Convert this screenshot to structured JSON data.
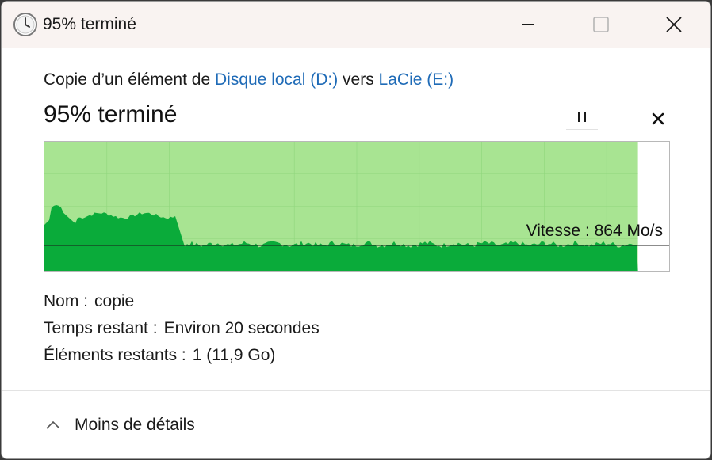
{
  "window": {
    "title": "95% terminé",
    "icon": "clock-icon"
  },
  "header": {
    "prefix": "Copie d’un élément de ",
    "source": "Disque local (D:)",
    "middle": " vers ",
    "destination": "LaCie (E:)"
  },
  "progress": {
    "title": "95% terminé",
    "percent": 95
  },
  "graph": {
    "speed_label": "Vitesse : 864 Mo/s",
    "speed_value_mbps": 864,
    "colors": {
      "completed_area": "#a8e492",
      "throughput": "#0aab3a",
      "grid": "#8fd67c"
    }
  },
  "details": {
    "name_label": "Nom :",
    "name_value": "copie",
    "time_label": "Temps restant :",
    "time_value": "Environ 20 secondes",
    "items_label": "Éléments restants :",
    "items_value": "1 (11,9 Go)"
  },
  "footer": {
    "toggle_label": "Moins de détails"
  }
}
